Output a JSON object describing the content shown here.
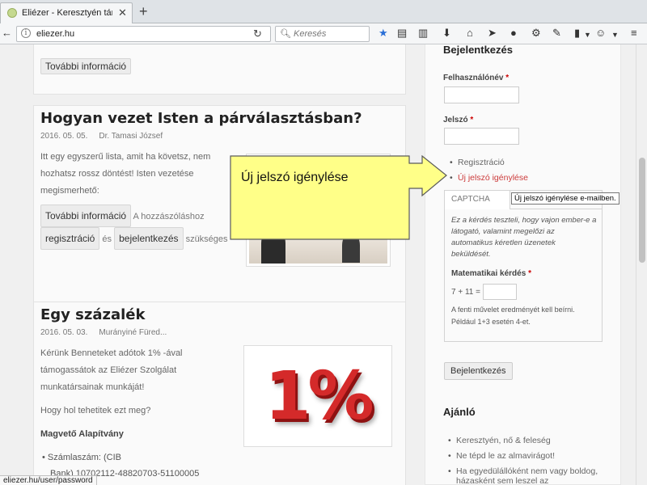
{
  "browser": {
    "tab_title": "Eliézer - Keresztyén társker...",
    "url": "eliezer.hu",
    "search_placeholder": "Keresés",
    "status_url": "eliezer.hu/user/password"
  },
  "posts": [
    {
      "more_btn": "További információ"
    },
    {
      "title": "Hogyan vezet Isten a párválasztásban?",
      "date": "2016. 05. 05.",
      "author": "Dr. Tamasi József",
      "excerpt": [
        "Itt egy egyszerű lista, amit ha követsz, nem",
        "hozhatsz rossz döntést! Isten vezetése",
        "megismerhető:"
      ],
      "more_btn": "További információ",
      "login_note_prefix": "A hozzászóláshoz",
      "register_btn": "regisztráció",
      "and_word": "és",
      "login_btn": "bejelentkezés",
      "login_note_suffix": "szükséges"
    },
    {
      "title": "Egy százalék",
      "date": "2016. 05. 03.",
      "author": "Murányiné Füred...",
      "excerpt": [
        "Kérünk Benneteket adótok 1% -ával",
        "támogassátok az Eliézer Szolgálat",
        "munkatársainak munkáját!"
      ],
      "question": "Hogy hol tehetitek ezt meg?",
      "org": "Magvető Alapítvány",
      "account_line1": "Számlaszám: (CIB",
      "account_line2": "Bank) 10702112-48820703-51100005",
      "image_text": "1%"
    }
  ],
  "sidebar": {
    "login_heading": "Bejelentkezés",
    "username_label": "Felhasználónév",
    "password_label": "Jelszó",
    "required_mark": "*",
    "links": [
      "Regisztráció",
      "Új jelszó igénylése"
    ],
    "captcha": {
      "tab": "CAPTCHA",
      "description": "Ez a kérdés teszteli, hogy vajon ember-e a látogató, valamint megelőzi az automatikus kéretlen üzenetek beküldését.",
      "math_label": "Matematikai kérdés",
      "equation": "7 + 11 =",
      "hint": "A fenti művelet eredményét kell beírni. Például 1+3 esetén 4-et."
    },
    "login_button": "Bejelentkezés",
    "recommend_heading": "Ajánló",
    "recommend": [
      "Keresztyén, nő & feleség",
      "Ne tépd le az almavirágot!",
      "Ha egyedülállóként nem vagy boldog,",
      "házasként sem leszel az"
    ]
  },
  "tooltip": "Új jelszó igénylése e-mailben.",
  "callout": "Új jelszó igénylése",
  "colors": {
    "callout_fill": "#ffff88",
    "link_red": "#cc3b3b"
  }
}
